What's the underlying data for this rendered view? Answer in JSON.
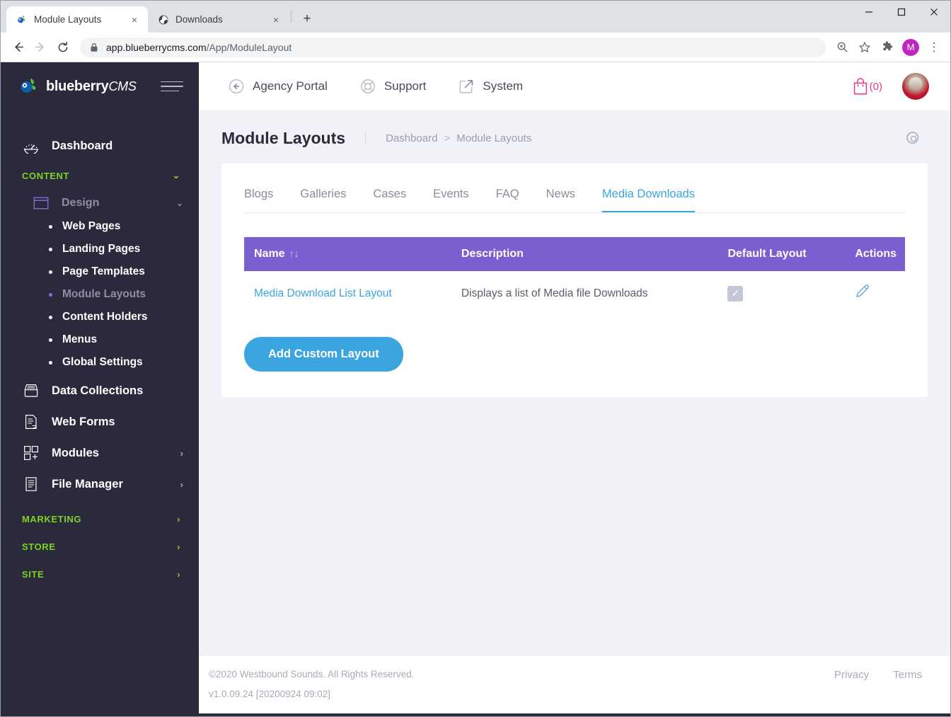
{
  "browser": {
    "tabs": [
      {
        "title": "Module Layouts",
        "favicon": "blueberry-icon",
        "active": true,
        "close_label": "×"
      },
      {
        "title": "Downloads",
        "favicon": "globe-icon",
        "active": false,
        "close_label": "×"
      }
    ],
    "new_tab_label": "+",
    "window_controls": {
      "minimize": "—",
      "maximize": "□",
      "close": "✕"
    },
    "nav": {
      "back": "←",
      "forward": "→",
      "reload": "⟳"
    },
    "address": {
      "host": "app.blueberrycms.com",
      "path": "/App/ModuleLayout",
      "lock": "lock-icon"
    },
    "toolbar_icons": [
      "zoom-icon",
      "bookmark-star-icon",
      "extensions-puzzle-icon",
      "profile-avatar",
      "more-menu-icon"
    ],
    "profile_initial": "M",
    "more_menu_label": "⋮"
  },
  "sidebar": {
    "brand": {
      "name": "blueberry",
      "suffix": "CMS"
    },
    "hamburger_label": "menu-toggle",
    "dashboard": {
      "label": "Dashboard",
      "icon": "gauge-icon"
    },
    "sections": [
      {
        "label": "CONTENT",
        "chevron": "⌄",
        "expanded": true,
        "groups": [
          {
            "label": "Design",
            "icon": "window-icon",
            "chevron": "⌄",
            "current": true,
            "items": [
              {
                "label": "Web Pages",
                "current": false
              },
              {
                "label": "Landing Pages",
                "current": false
              },
              {
                "label": "Page Templates",
                "current": false
              },
              {
                "label": "Module Layouts",
                "current": true
              },
              {
                "label": "Content Holders",
                "current": false
              },
              {
                "label": "Menus",
                "current": false
              },
              {
                "label": "Global Settings",
                "current": false
              }
            ]
          }
        ],
        "links": [
          {
            "label": "Data Collections",
            "icon": "inbox-icon",
            "chevron": ""
          },
          {
            "label": "Web Forms",
            "icon": "form-icon",
            "chevron": ""
          },
          {
            "label": "Modules",
            "icon": "modules-grid-icon",
            "chevron": "›"
          },
          {
            "label": "File Manager",
            "icon": "document-icon",
            "chevron": "›"
          }
        ]
      },
      {
        "label": "MARKETING",
        "chevron": "›",
        "expanded": false,
        "groups": [],
        "links": []
      },
      {
        "label": "STORE",
        "chevron": "›",
        "expanded": false,
        "groups": [],
        "links": []
      },
      {
        "label": "SITE",
        "chevron": "›",
        "expanded": false,
        "groups": [],
        "links": []
      }
    ]
  },
  "topbar": {
    "items": [
      {
        "label": "Agency Portal",
        "icon": "circle-arrow-left-icon"
      },
      {
        "label": "Support",
        "icon": "lifebuoy-icon"
      },
      {
        "label": "System",
        "icon": "external-link-icon"
      }
    ],
    "cart": {
      "icon": "shopping-bag-icon",
      "count_label": "(0)"
    },
    "avatar": "user-avatar"
  },
  "page": {
    "title": "Module Layouts",
    "breadcrumb": {
      "root": "Dashboard",
      "separator": ">",
      "current": "Module Layouts"
    },
    "settings_icon": "gear-icon"
  },
  "tabs": [
    {
      "label": "Blogs",
      "active": false
    },
    {
      "label": "Galleries",
      "active": false
    },
    {
      "label": "Cases",
      "active": false
    },
    {
      "label": "Events",
      "active": false
    },
    {
      "label": "FAQ",
      "active": false
    },
    {
      "label": "News",
      "active": false
    },
    {
      "label": "Media Downloads",
      "active": true
    }
  ],
  "table": {
    "columns": [
      "Name",
      "Description",
      "Default Layout",
      "Actions"
    ],
    "sort_icon": "↑↓",
    "rows": [
      {
        "name": "Media Download List Layout",
        "description": "Displays a list of Media file Downloads",
        "default_layout": true,
        "checkmark": "✓",
        "action_icon": "edit-pencil-icon"
      }
    ]
  },
  "actions": {
    "add_layout_label": "Add Custom Layout"
  },
  "footer": {
    "copyright": "©2020 Westbound Sounds. All Rights Reserved.",
    "version": "v1.0.09.24 [20200924 09:02]",
    "links": [
      {
        "label": "Privacy"
      },
      {
        "label": "Terms"
      }
    ]
  },
  "colors": {
    "sidebar_bg": "#2b2a3d",
    "accent_blue": "#3ba5e0",
    "table_header_purple": "#7b5fd0",
    "section_green": "#7ed321",
    "cart_pink": "#e8368f",
    "content_bg": "#f1f2f7"
  }
}
